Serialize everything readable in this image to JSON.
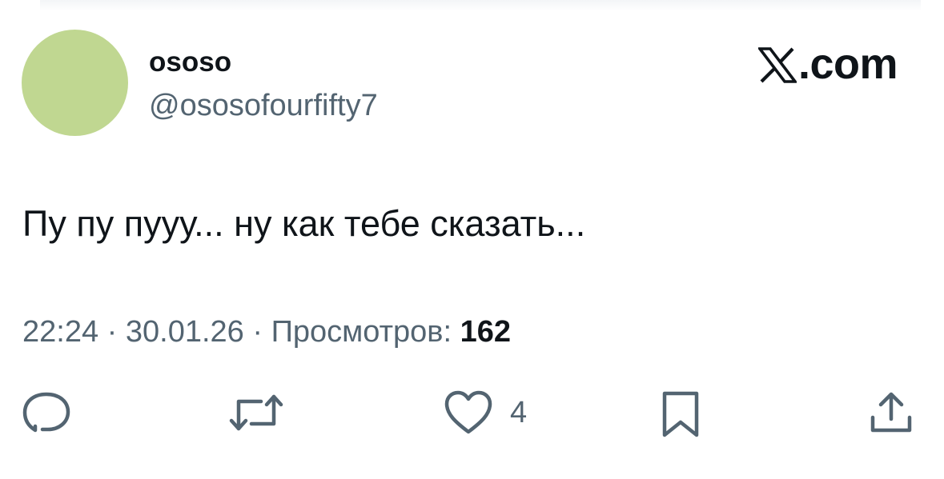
{
  "author": {
    "display_name": "ososo",
    "handle": "@ososofourfifty7",
    "avatar_color": "#c0d791"
  },
  "brand": {
    "logo_icon": "x-logo-icon",
    "label": ".com"
  },
  "tweet": {
    "text": "Пу пу пууу... ну как тебе сказать..."
  },
  "meta": {
    "time": "22:24",
    "separator": "·",
    "date": "30.01.26",
    "views_label": "Просмотров:",
    "views_count": "162"
  },
  "actions": {
    "reply_icon": "reply-icon",
    "retweet_icon": "retweet-icon",
    "like_icon": "heart-icon",
    "like_count": "4",
    "bookmark_icon": "bookmark-icon",
    "share_icon": "share-icon"
  },
  "colors": {
    "text_primary": "#0f1419",
    "text_secondary": "#536471"
  }
}
